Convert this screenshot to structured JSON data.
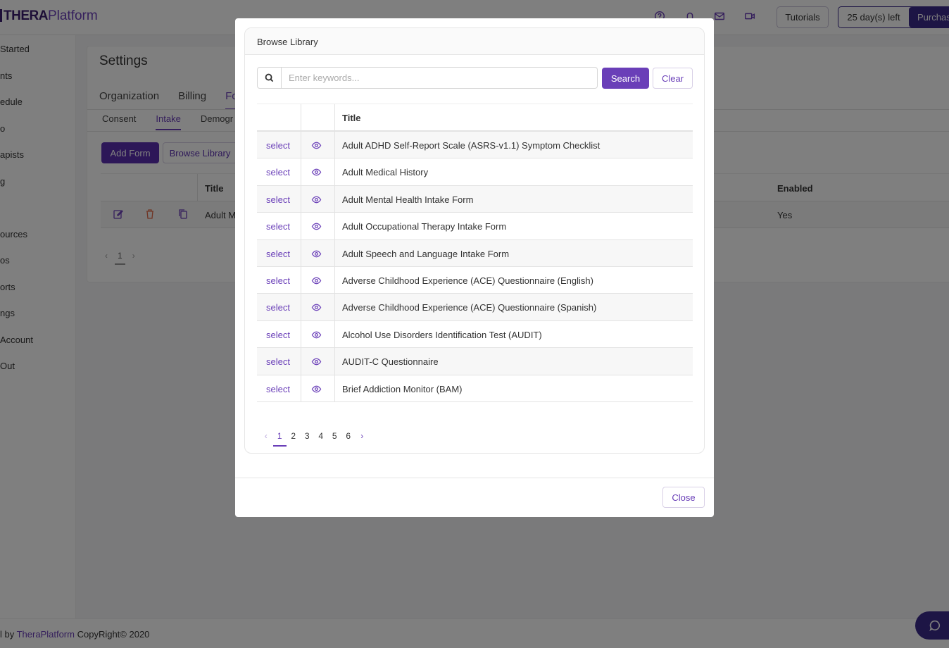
{
  "app": {
    "logo_prefix": "THERA",
    "logo_suffix": "Platform",
    "tutorials_label": "Tutorials",
    "trial_days": "25 day(s) left",
    "purchase_label": "Purchase"
  },
  "sidebar": {
    "items": [
      "Started",
      "nts",
      "edule",
      "o",
      "apists",
      "g",
      "",
      "ources",
      "os",
      "orts",
      "ngs",
      "Account",
      " Out"
    ]
  },
  "settings": {
    "title": "Settings",
    "tabs": [
      "Organization",
      "Billing",
      "Fo"
    ],
    "subtabs": [
      "Consent",
      "Intake",
      "Demogr"
    ],
    "add_form_label": "Add Form",
    "browse_library_label": "Browse Library",
    "table": {
      "col_title": "Title",
      "col_enabled": "Enabled",
      "row_title": "Adult M",
      "row_enabled": "Yes"
    },
    "pager_current": "1"
  },
  "footer": {
    "prefix": "l by ",
    "brand": "TheraPlatform",
    "suffix": " CopyRight© 2020"
  },
  "modal": {
    "title": "Browse Library",
    "search": {
      "placeholder": "Enter keywords...",
      "value": "",
      "search_label": "Search",
      "clear_label": "Clear"
    },
    "table_header": "Title",
    "select_label": "select",
    "rows": [
      "Adult ADHD Self-Report Scale (ASRS-v1.1) Symptom Checklist",
      "Adult Medical History",
      "Adult Mental Health Intake Form",
      "Adult Occupational Therapy Intake Form",
      "Adult Speech and Language Intake Form",
      "Adverse Childhood Experience (ACE) Questionnaire (English)",
      "Adverse Childhood Experience (ACE) Questionnaire (Spanish)",
      "Alcohol Use Disorders Identification Test (AUDIT)",
      "AUDIT-C Questionnaire",
      "Brief Addiction Monitor (BAM)"
    ],
    "pagination": {
      "pages": [
        "1",
        "2",
        "3",
        "4",
        "5",
        "6"
      ],
      "current": "1"
    },
    "close_label": "Close"
  },
  "colors": {
    "accent": "#6a3fb8",
    "brand_dark": "#3b2a8a"
  }
}
